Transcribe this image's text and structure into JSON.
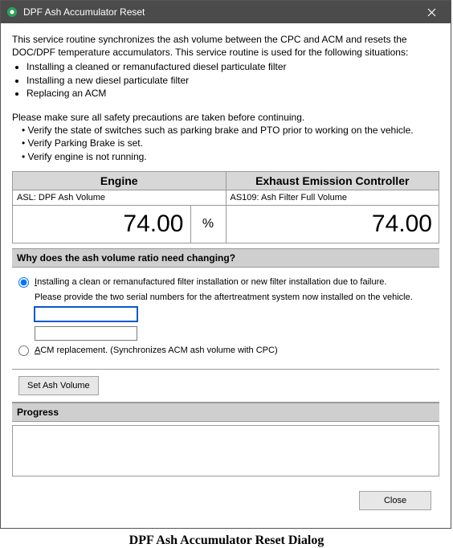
{
  "window": {
    "title": "DPF Ash Accumulator Reset"
  },
  "intro": {
    "p1": "This service routine synchronizes the ash volume between the CPC and ACM and resets the DOC/DPF temperature accumulators. This service routine is used for the following situations:",
    "bullets": [
      "Installing a cleaned or remanufactured diesel particulate filter",
      "Installing a new diesel particulate filter",
      "Replacing an ACM"
    ],
    "p2": "Please make sure all safety precautions are taken before continuing.",
    "p2bullets": [
      "Verify the state of switches such as parking brake and PTO prior to working on the vehicle.",
      "Verify Parking Brake is set.",
      "Verify engine is not running."
    ]
  },
  "panels": {
    "left": {
      "header": "Engine",
      "sub": "ASL: DPF Ash Volume",
      "value": "74.00",
      "unit": "%"
    },
    "right": {
      "header": "Exhaust Emission Controller",
      "sub": "AS109: Ash Filter Full Volume",
      "value": "74.00"
    }
  },
  "question": "Why does the ash volume ratio need changing?",
  "options": {
    "opt1": "Installing a clean or remanufactured filter installation or new filter installation due to failure.",
    "opt1_sub": "Please provide the two serial numbers for the aftertreatment system now installed on the vehicle.",
    "serial1": "",
    "serial2": "",
    "opt2": "ACM replacement. (Synchronizes ACM ash volume with CPC)"
  },
  "buttons": {
    "setash": "Set Ash Volume",
    "close": "Close"
  },
  "progress_label": "Progress",
  "caption": "DPF Ash Accumulator Reset Dialog"
}
